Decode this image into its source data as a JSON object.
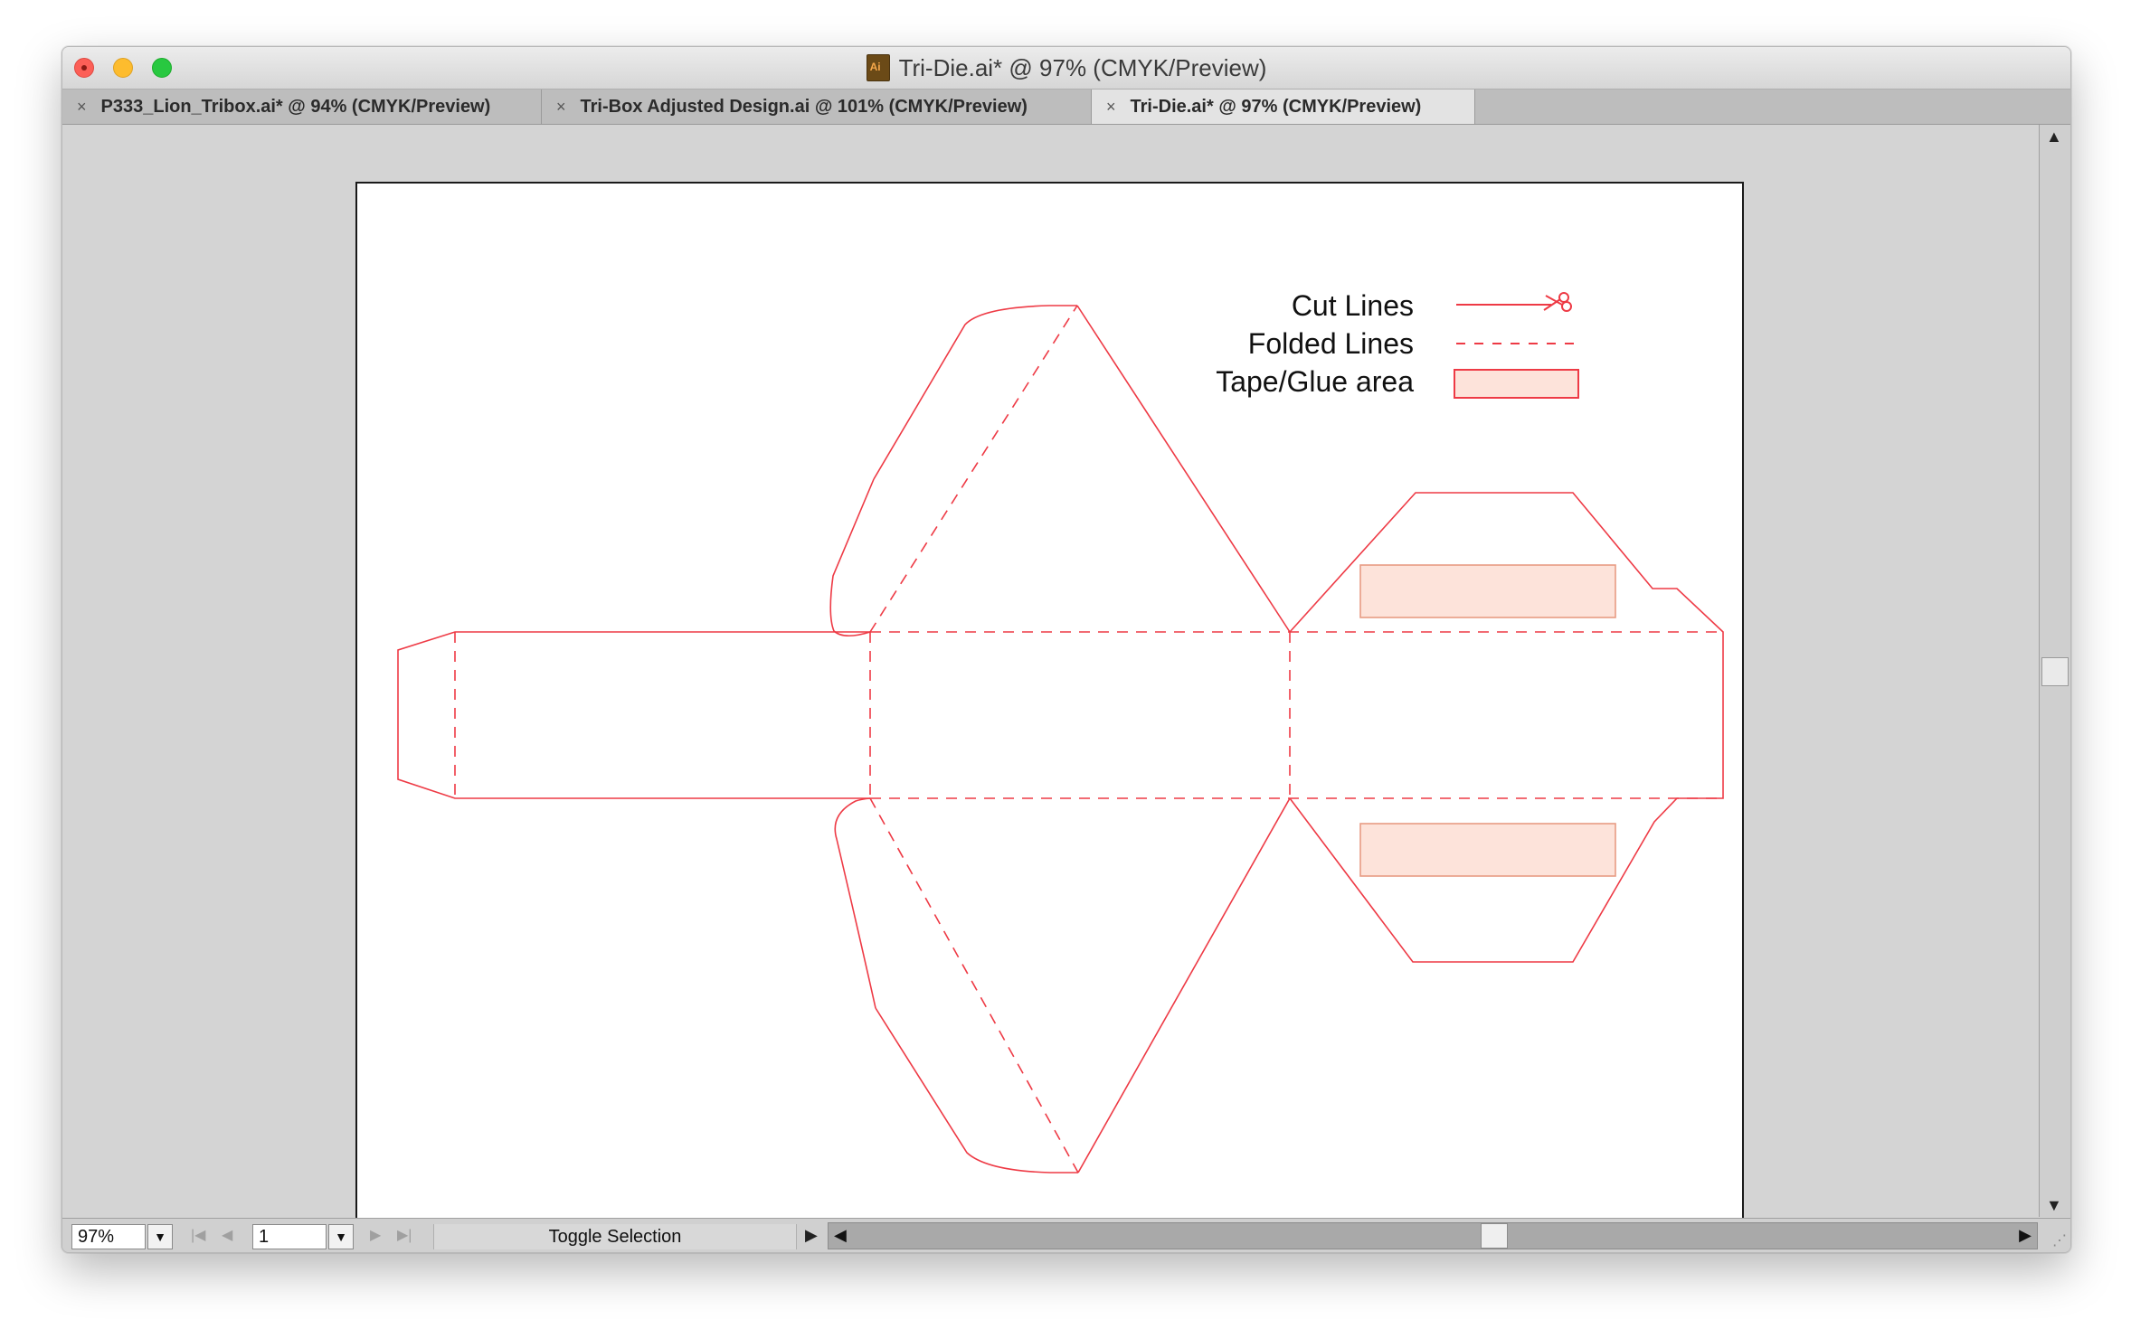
{
  "window": {
    "title": "Tri-Die.ai* @ 97% (CMYK/Preview)",
    "file_icon": "illustrator-file-icon"
  },
  "tabs": [
    {
      "label": "P333_Lion_Tribox.ai* @ 94% (CMYK/Preview)",
      "close": "×",
      "active": false
    },
    {
      "label": "Tri-Box Adjusted Design.ai @ 101% (CMYK/Preview)",
      "close": "×",
      "active": false
    },
    {
      "label": "Tri-Die.ai* @ 97% (CMYK/Preview)",
      "close": "×",
      "active": true
    }
  ],
  "legend": {
    "cut": "Cut Lines",
    "fold": "Folded Lines",
    "glue": "Tape/Glue area"
  },
  "colors": {
    "die_line": "#ee3a45",
    "glue_fill": "#fde3da",
    "glue_stroke": "#e89b83"
  },
  "statusbar": {
    "zoom": "97%",
    "page": "1",
    "toggle": "Toggle Selection"
  }
}
